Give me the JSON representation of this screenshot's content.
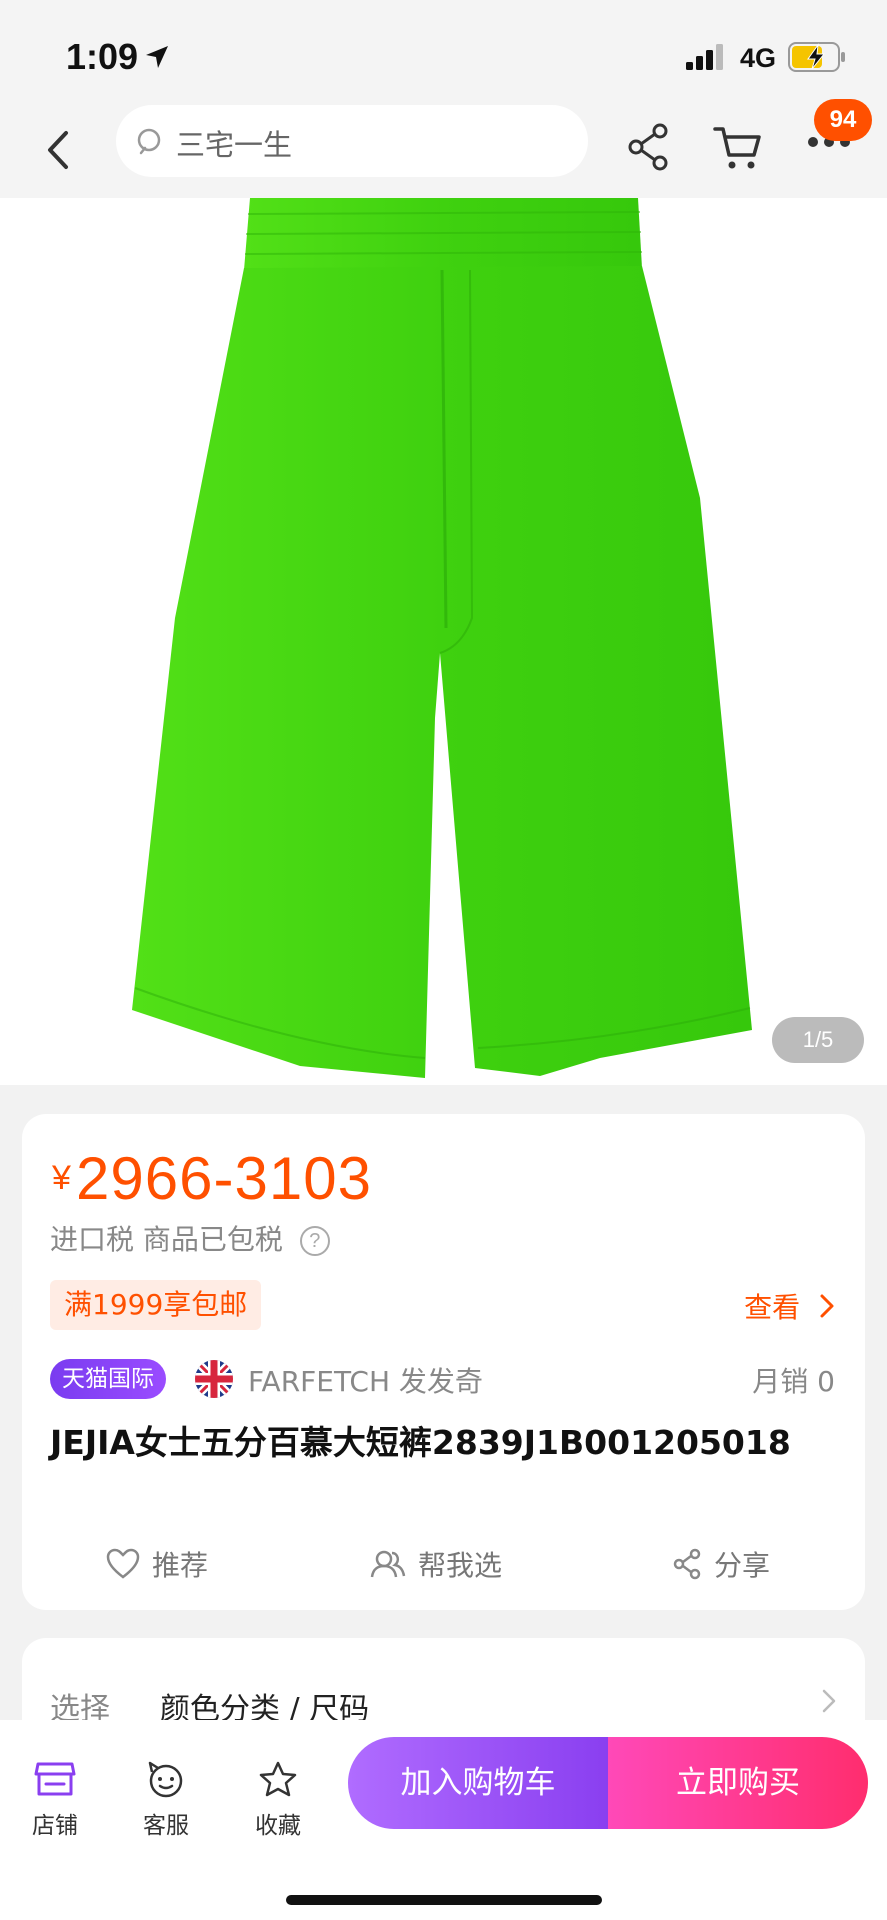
{
  "status_bar": {
    "time": "1:09",
    "network": "4G"
  },
  "nav": {
    "search_text": "三宅一生",
    "cart_badge": "94"
  },
  "gallery": {
    "counter": "1/5",
    "product_color": "#3ed10f"
  },
  "price": {
    "symbol": "¥",
    "value": "2966-3103"
  },
  "tax": {
    "text": "进口税 商品已包税",
    "help": "?"
  },
  "promo": {
    "tag": "满1999享包邮",
    "more": "查看"
  },
  "seller": {
    "badge": "天猫国际",
    "name": "FARFETCH 发发奇",
    "monthly_sales": "月销 0"
  },
  "product": {
    "title": "JEJIA女士五分百慕大短裤2839J1B001205018"
  },
  "actions": {
    "recommend": "推荐",
    "help_choose": "帮我选",
    "share": "分享"
  },
  "options": {
    "label": "选择",
    "value": "颜色分类 / 尺码"
  },
  "bottom_bar": {
    "store": "店铺",
    "service": "客服",
    "favorite": "收藏",
    "add_to_cart": "加入购物车",
    "buy_now": "立即购买"
  },
  "colors": {
    "accent": "#ff5000",
    "tmall_purple": "#8a3ff0",
    "buy_pink": "#ff2d6e"
  }
}
